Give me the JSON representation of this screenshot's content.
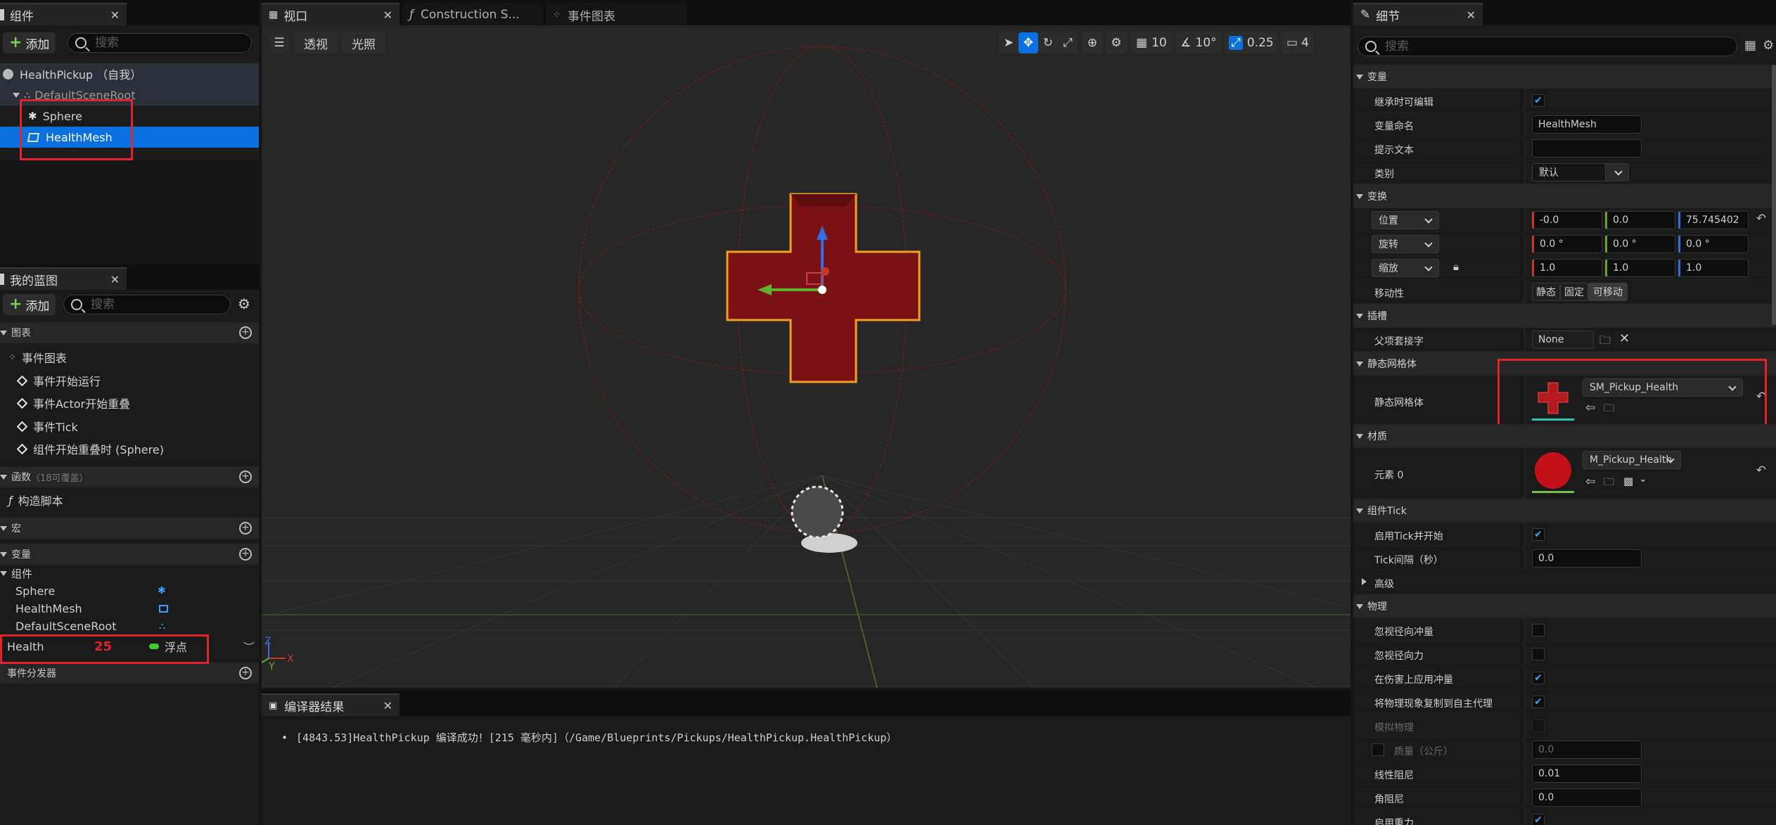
{
  "components_panel": {
    "tab_title": "组件",
    "add_label": "添加",
    "search_placeholder": "搜索",
    "tree": {
      "root": "HealthPickup （自我）",
      "scene_root": "DefaultSceneRoot",
      "children": [
        "Sphere",
        "HealthMesh"
      ]
    }
  },
  "blueprint_panel": {
    "tab_title": "我的蓝图",
    "add_label": "添加",
    "search_placeholder": "搜索",
    "sections": {
      "graphs": "图表",
      "functions": "函数",
      "functions_hint": "（18可覆盖）",
      "macros": "宏",
      "variables": "变量",
      "dispatchers": "事件分发器"
    },
    "event_graph": "事件图表",
    "events": [
      "事件开始运行",
      "事件Actor开始重叠",
      "事件Tick",
      "组件开始重叠时 (Sphere)"
    ],
    "construction_script": "构造脚本",
    "components_group": "组件",
    "component_vars": [
      "Sphere",
      "HealthMesh",
      "DefaultSceneRoot"
    ],
    "health_var": {
      "name": "Health",
      "value": "25",
      "type": "浮点"
    }
  },
  "viewport": {
    "tabs": [
      {
        "label": "视口",
        "icon": "viewport-grid-icon"
      },
      {
        "label": "Construction S...",
        "icon": "function-icon"
      },
      {
        "label": "事件图表",
        "icon": "graph-icon"
      }
    ],
    "perspective": "透视",
    "lighting": "光照",
    "grid_snap": "10",
    "rotation_snap": "10°",
    "scale_snap": "0.25",
    "camera_speed": "4"
  },
  "compiler": {
    "tab_title": "编译器结果",
    "message": "[4843.53]HealthPickup 编译成功！[215 毫秒内]（/Game/Blueprints/Pickups/HealthPickup.HealthPickup）"
  },
  "details": {
    "tab_title": "细节",
    "search_placeholder": "搜索",
    "variable_section": "变量",
    "editable_label": "继承时可编辑",
    "var_name_label": "变量命名",
    "var_name_value": "HealthMesh",
    "tooltip_label": "提示文本",
    "category_label": "类别",
    "category_value": "默认",
    "transform_section": "变换",
    "location_label": "位置",
    "location": [
      "-0.0",
      "0.0",
      "75.745402"
    ],
    "rotation_label": "旋转",
    "rotation": [
      "0.0 °",
      "0.0 °",
      "0.0 °"
    ],
    "scale_label": "缩放",
    "scale": [
      "1.0",
      "1.0",
      "1.0"
    ],
    "mobility_label": "移动性",
    "mobility_options": [
      "静态",
      "固定",
      "可移动"
    ],
    "socket_section": "插槽",
    "parent_socket_label": "父项套接字",
    "parent_socket_value": "None",
    "static_mesh_section": "静态网格体",
    "static_mesh_label": "静态网格体",
    "static_mesh_value": "SM_Pickup_Health",
    "materials_section": "材质",
    "element0_label": "元素 0",
    "material_value": "M_Pickup_Health",
    "tick_section": "组件Tick",
    "tick_start_label": "启用Tick并开始",
    "tick_interval_label": "Tick间隔（秒）",
    "tick_interval_value": "0.0",
    "advanced_section": "高级",
    "physics_section": "物理",
    "ignore_radial_impulse": "忽视径向冲量",
    "ignore_radial_force": "忽视径向力",
    "apply_impulse_damage": "在伤害上应用冲量",
    "replicate_physics": "将物理现象复制到自主代理",
    "simulate_physics": "模拟物理",
    "mass_label": "质量（公斤）",
    "mass_value": "0.0",
    "linear_damping_label": "线性阻尼",
    "linear_damping_value": "0.01",
    "angular_damping_label": "角阻尼",
    "angular_damping_value": "0.0",
    "enable_gravity_label": "启用重力"
  },
  "colors": {
    "selection": "#0a70e0",
    "highlight_box": "#e3222b",
    "mesh_red": "#7a1114",
    "mesh_outline": "#f0a020"
  }
}
